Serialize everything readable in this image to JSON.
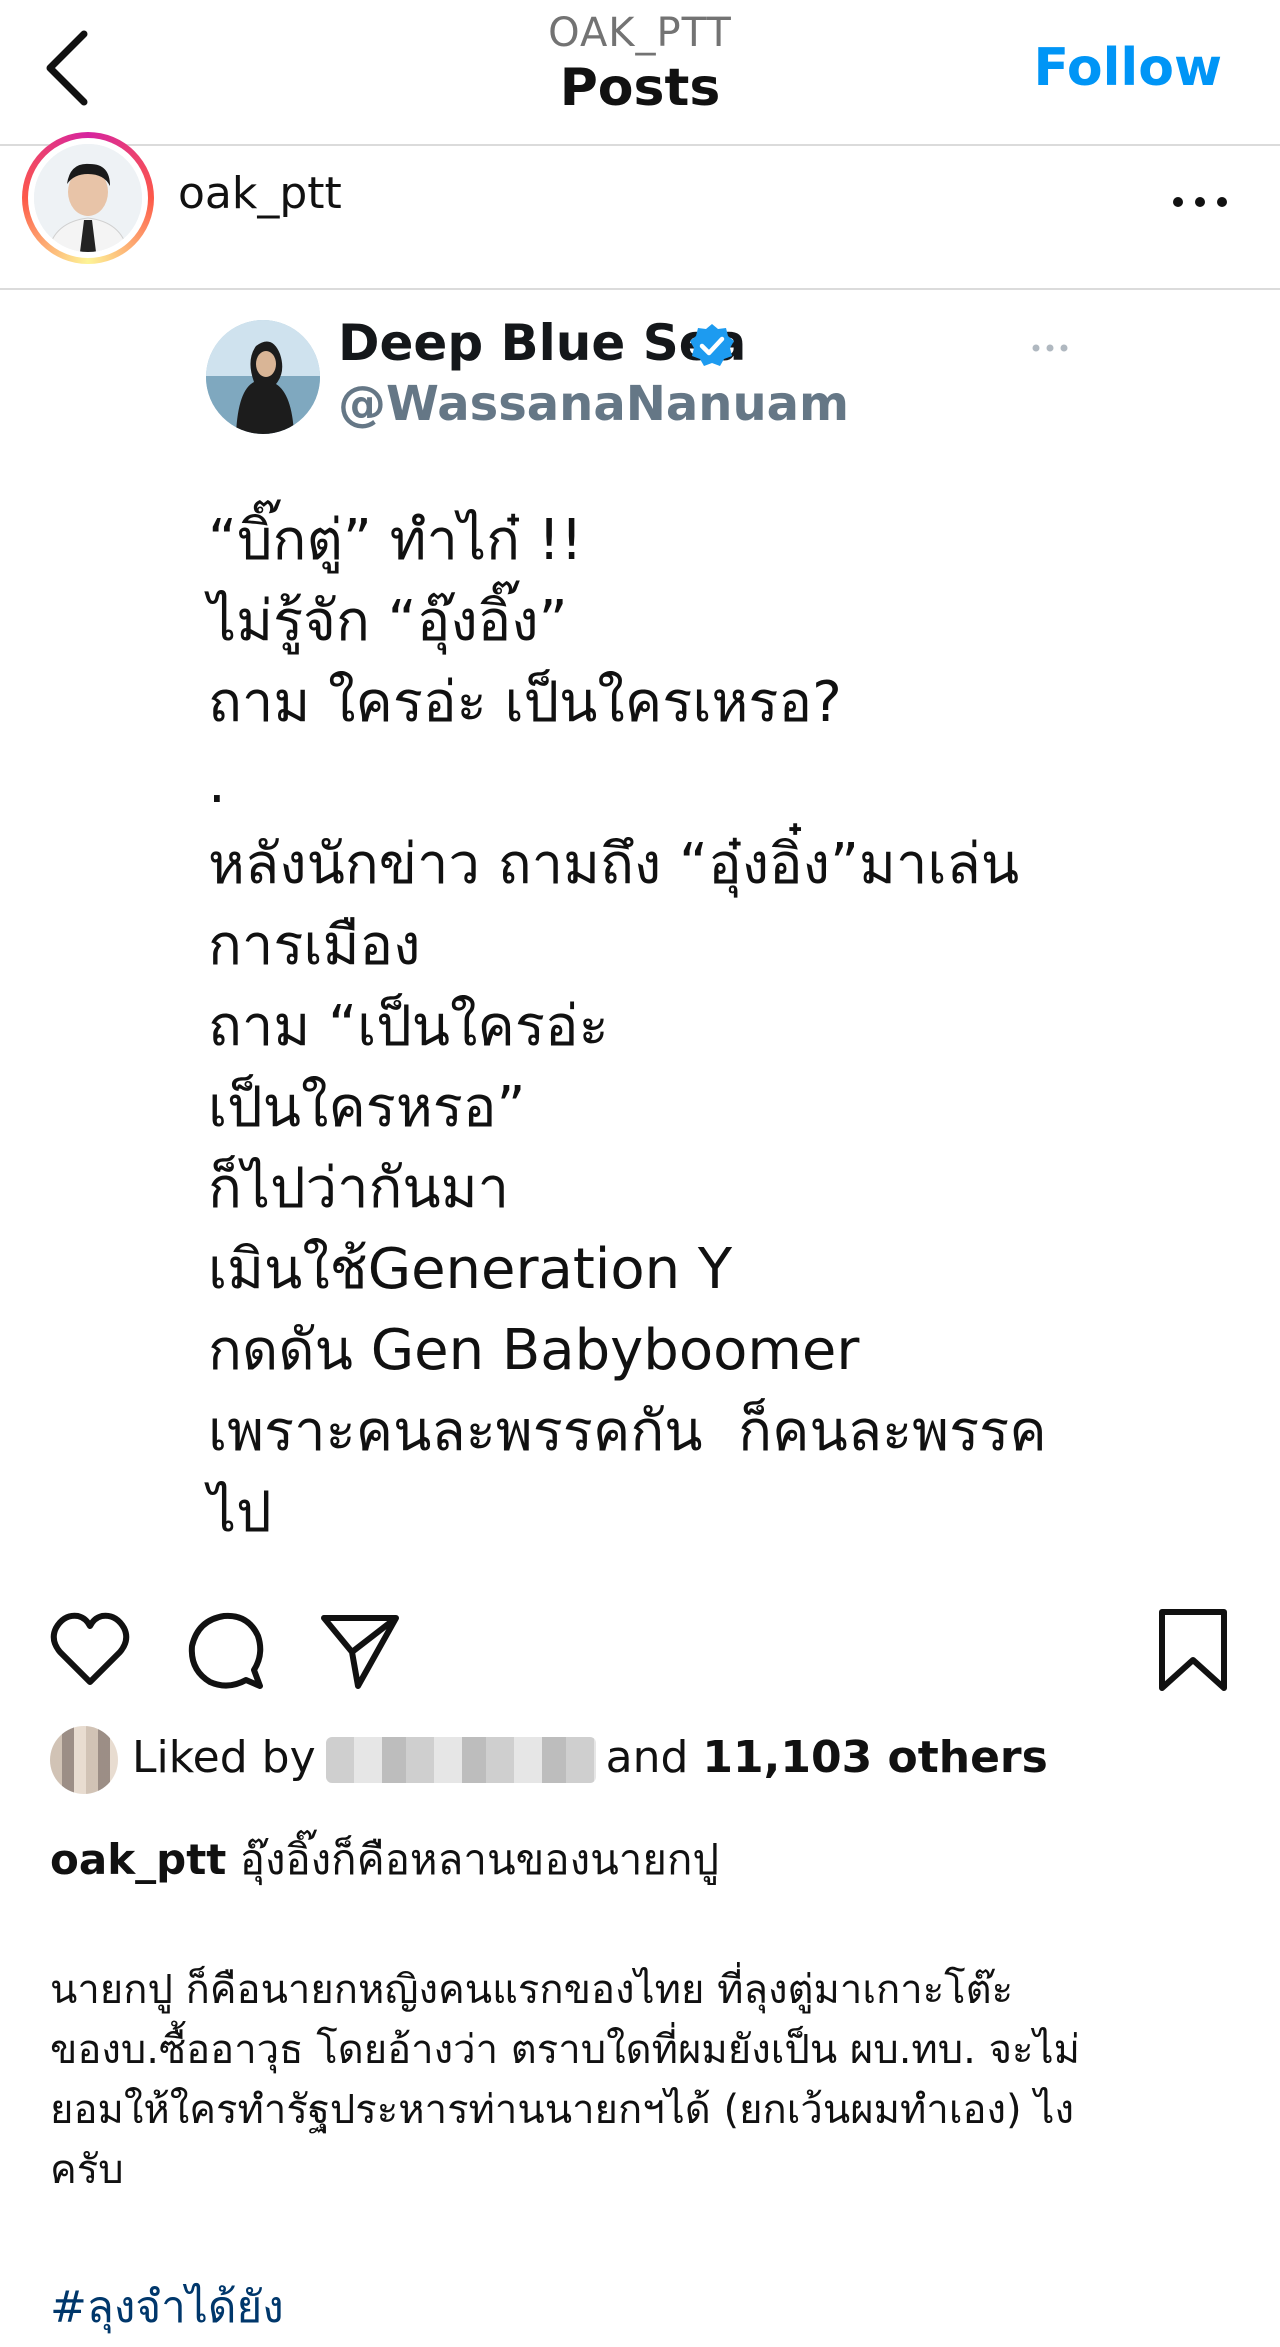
{
  "topbar": {
    "account_name": "OAK_PTT",
    "title": "Posts",
    "follow_label": "Follow",
    "back_icon": "chevron-left-icon"
  },
  "post": {
    "username": "oak_ptt",
    "more_icon": "more-horizontal-icon"
  },
  "tweet": {
    "display_name": "Deep Blue Sea",
    "handle": "@WassanaNanuam",
    "verified": true,
    "text": "“บิ๊กตู่” ทำไก๋ !!\nไม่รู้จัก “อุ๊งอิ๊ง”\nถาม ใครอ่ะ เป็นใครเหรอ?\n.\nหลังนักข่าว ถามถึง “อุ๋งอิ๋ง”มาเล่น\nการเมือง\nถาม “เป็นใครอ่ะ\nเป็นใครหรอ”\nก็ไปว่ากันมา\nเมินใช้Generation Y\nกดดัน Gen Babyboomer\nเพราะคนละพรรคกัน  ก็คนละพรรค\nไป"
  },
  "actions": {
    "like_icon": "heart-icon",
    "comment_icon": "comment-icon",
    "share_icon": "send-icon",
    "save_icon": "bookmark-icon"
  },
  "likes": {
    "prefix": "Liked by",
    "middle": "and",
    "count_text": "11,103 others"
  },
  "caption": {
    "username": "oak_ptt",
    "first_line": "อุ๊งอิ๊งก็คือหลานของนายกปู",
    "body": "นายกปู ก็คือนายกหญิงคนแรกของไทย ที่ลุงตู่มาเกาะโต๊ะ\nของบ.ซื้ออาวุธ โดยอ้างว่า ตราบใดที่ผมยังเป็น ผบ.ทบ. จะไม่\nยอมให้ใครทำรัฐประหารท่านนายกฯได้ (ยกเว้นผมทำเอง) ไง\nครับ",
    "hashtag": "#ลุงจำได้ยัง"
  },
  "colors": {
    "accent": "#0095f6",
    "verified": "#1d9bf0",
    "hashtag": "#00376b",
    "divider": "#dbdbdb"
  }
}
